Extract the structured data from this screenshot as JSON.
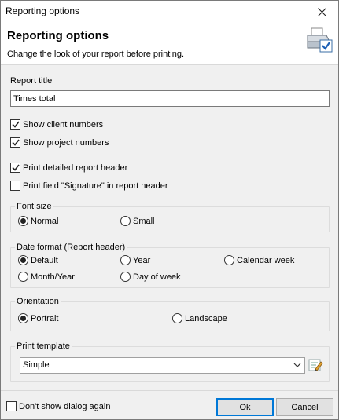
{
  "window": {
    "title": "Reporting options"
  },
  "header": {
    "heading": "Reporting options",
    "subheading": "Change the look of your report before printing.",
    "icon": "printer-check-icon"
  },
  "report_title": {
    "label": "Report title",
    "value": "Times total"
  },
  "checkboxes": {
    "show_client_numbers": {
      "label": "Show client numbers",
      "checked": true
    },
    "show_project_numbers": {
      "label": "Show project numbers",
      "checked": true
    },
    "print_detailed_header": {
      "label": "Print detailed report header",
      "checked": true
    },
    "print_signature": {
      "label": "Print field \"Signature\" in report header",
      "checked": false
    }
  },
  "font_size": {
    "label": "Font size",
    "options": [
      {
        "label": "Normal",
        "selected": true
      },
      {
        "label": "Small",
        "selected": false
      }
    ]
  },
  "date_format": {
    "label": "Date format (Report header)",
    "options": [
      {
        "label": "Default",
        "selected": true
      },
      {
        "label": "Year",
        "selected": false
      },
      {
        "label": "Calendar week",
        "selected": false
      },
      {
        "label": "Month/Year",
        "selected": false
      },
      {
        "label": "Day of week",
        "selected": false
      }
    ]
  },
  "orientation": {
    "label": "Orientation",
    "options": [
      {
        "label": "Portrait",
        "selected": true
      },
      {
        "label": "Landscape",
        "selected": false
      }
    ]
  },
  "print_template": {
    "label": "Print template",
    "value": "Simple"
  },
  "footer": {
    "dont_show_label": "Don't show dialog again",
    "ok_label": "Ok",
    "cancel_label": "Cancel"
  },
  "colors": {
    "accent": "#0078d7",
    "window_bg": "#f0f0f0"
  }
}
